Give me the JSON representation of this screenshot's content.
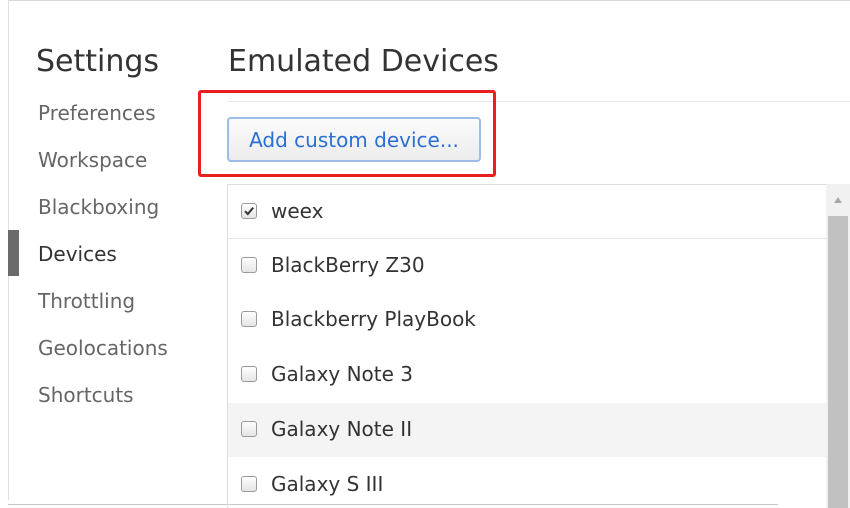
{
  "sidebar": {
    "title": "Settings",
    "items": [
      {
        "label": "Preferences",
        "selected": false
      },
      {
        "label": "Workspace",
        "selected": false
      },
      {
        "label": "Blackboxing",
        "selected": false
      },
      {
        "label": "Devices",
        "selected": true
      },
      {
        "label": "Throttling",
        "selected": false
      },
      {
        "label": "Geolocations",
        "selected": false
      },
      {
        "label": "Shortcuts",
        "selected": false
      }
    ]
  },
  "main": {
    "title": "Emulated Devices",
    "add_button_label": "Add custom device...",
    "highlight_color": "#e8201d",
    "devices": [
      {
        "label": "weex",
        "checked": true
      },
      {
        "label": "BlackBerry Z30",
        "checked": false
      },
      {
        "label": "Blackberry PlayBook",
        "checked": false
      },
      {
        "label": "Galaxy Note 3",
        "checked": false
      },
      {
        "label": "Galaxy Note II",
        "checked": false
      },
      {
        "label": "Galaxy S III",
        "checked": false
      }
    ]
  },
  "icons": {
    "checkbox_checked": "check-icon",
    "scroll_up": "arrow-up-icon"
  }
}
